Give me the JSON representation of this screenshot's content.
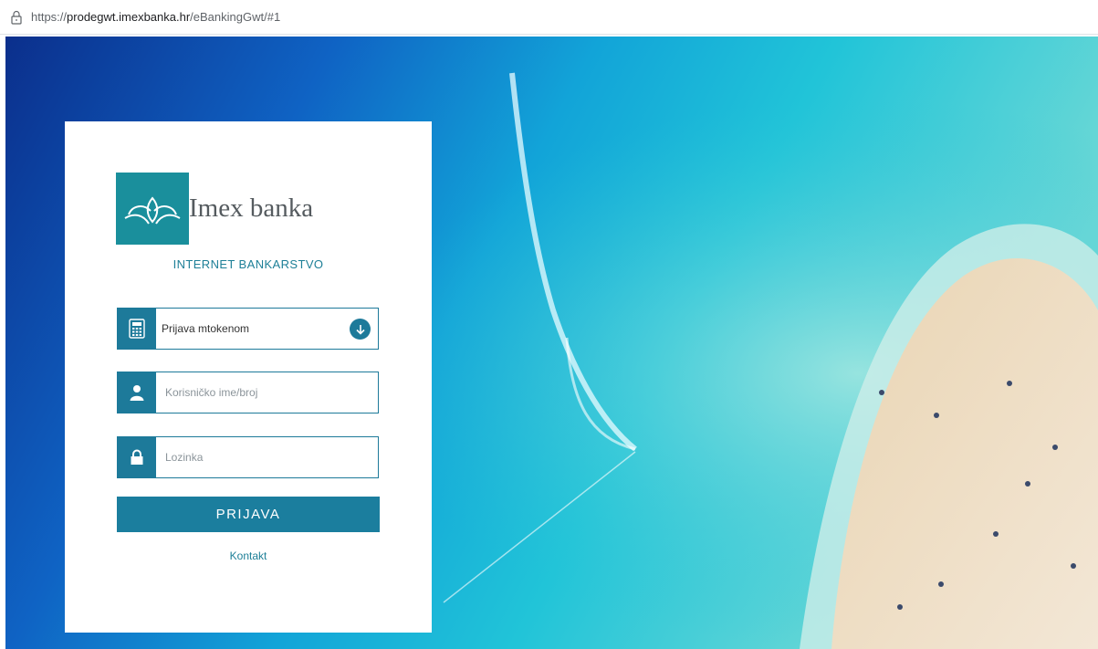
{
  "browser": {
    "url_scheme": "https://",
    "url_host": "prodegwt.imexbanka.hr",
    "url_path": "/eBankingGwt/#1",
    "icons": {
      "lock": "lock-icon"
    }
  },
  "login": {
    "logo_text": "Imex banka",
    "subtitle": "INTERNET BANKARSTVO",
    "method_select": {
      "value": "Prijava mtokenom",
      "icon": "calculator-icon",
      "arrow_icon": "arrow-down-circle-icon"
    },
    "username": {
      "placeholder": "Korisničko ime/broj",
      "icon": "user-icon"
    },
    "password": {
      "placeholder": "Lozinka",
      "icon": "lock-icon"
    },
    "submit_label": "PRIJAVA",
    "contact_link": "Kontakt"
  },
  "colors": {
    "brand_teal": "#1a8f9c",
    "primary_blue": "#1b7e9e",
    "link": "#1d7f97"
  }
}
